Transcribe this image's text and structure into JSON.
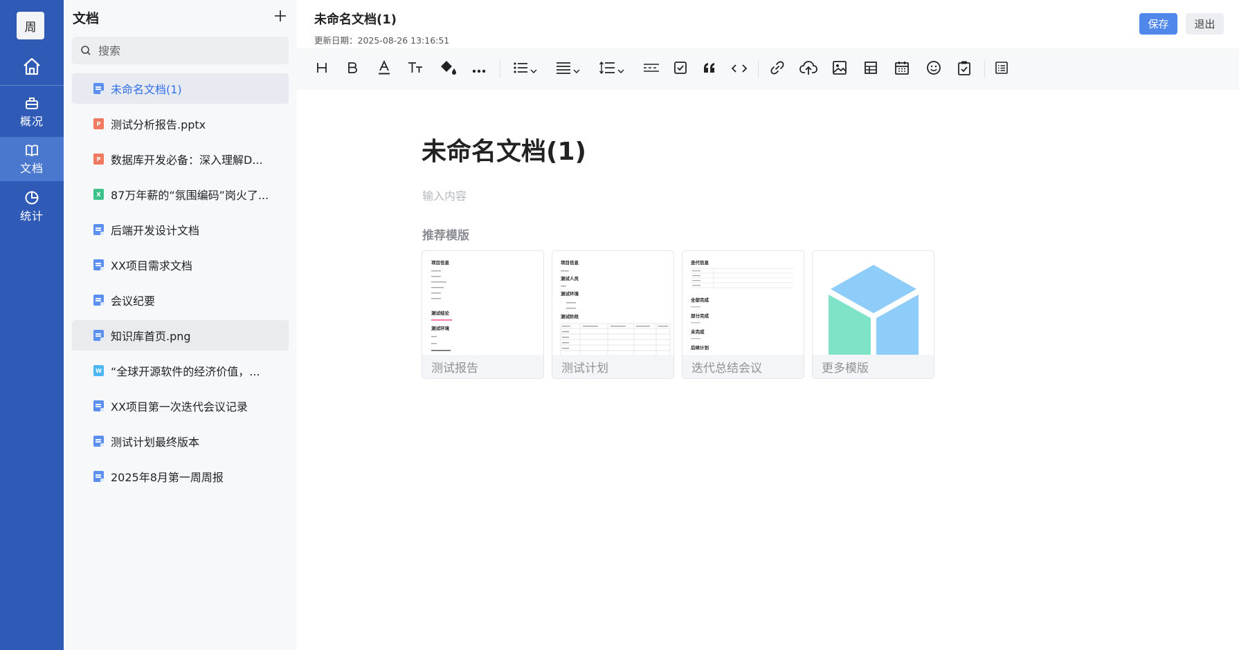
{
  "rail": {
    "avatar": "周",
    "items": [
      {
        "label": "概况"
      },
      {
        "label": "文档"
      },
      {
        "label": "统计"
      }
    ]
  },
  "panel": {
    "title": "文档",
    "search_placeholder": "搜索",
    "docs": [
      {
        "name": "未命名文档(1)",
        "type": "doc"
      },
      {
        "name": "测试分析报告.pptx",
        "type": "ppt",
        "icon_text": "P"
      },
      {
        "name": "数据库开发必备：深入理解D...",
        "type": "ppt",
        "icon_text": "P"
      },
      {
        "name": "87万年薪的“氛围编码”岗火了...",
        "type": "xls",
        "icon_text": "X"
      },
      {
        "name": "后端开发设计文档",
        "type": "doc"
      },
      {
        "name": "XX项目需求文档",
        "type": "doc"
      },
      {
        "name": "会议纪要",
        "type": "doc"
      },
      {
        "name": "知识库首页.png",
        "type": "doc"
      },
      {
        "name": "“全球开源软件的经济价值，...",
        "type": "wrd",
        "icon_text": "W"
      },
      {
        "name": "XX项目第一次迭代会议记录",
        "type": "doc"
      },
      {
        "name": "测试计划最终版本",
        "type": "doc"
      },
      {
        "name": "2025年8月第一周周报",
        "type": "doc"
      }
    ]
  },
  "header": {
    "title": "未命名文档(1)",
    "updated": "更新日期：2025-08-26 13:16:51",
    "save_label": "保存",
    "exit_label": "退出"
  },
  "editor": {
    "title": "未命名文档(1)",
    "placeholder": "输入内容",
    "templates_heading": "推荐模版",
    "templates": [
      {
        "name": "测试报告",
        "thumb": {
          "h1": "项目信息",
          "h2": "测试结论",
          "h3": "测试环境"
        }
      },
      {
        "name": "测试计划",
        "thumb": {
          "h1": "项目信息",
          "h2": "测试人员",
          "h3": "测试环境",
          "h4": "测试阶段"
        }
      },
      {
        "name": "迭代总结会议",
        "thumb": {
          "h1": "迭代信息",
          "h2": "全部完成",
          "h3": "部分完成",
          "h4": "未完成",
          "h5": "后续计划"
        }
      },
      {
        "name": "更多模版"
      }
    ]
  },
  "colors": {
    "rail": "#2f5bb7",
    "accent": "#4f87ea",
    "active_text": "#2f6ee6"
  }
}
